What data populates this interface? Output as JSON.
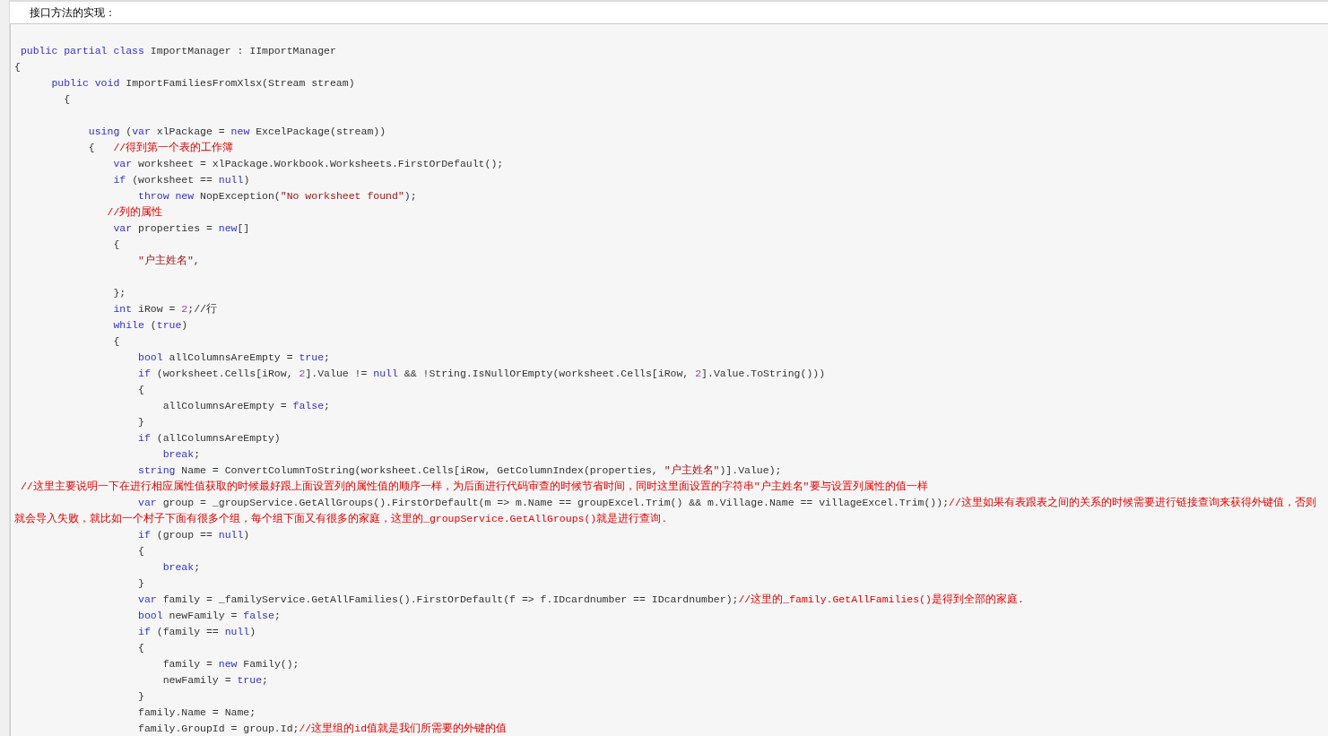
{
  "heading": "接口方法的实现：",
  "code_lines": [
    [
      {
        "kind": "keyword",
        "text": " public partial class"
      },
      {
        "kind": "plain",
        "text": " ImportManager : IImportManager"
      }
    ],
    [
      {
        "kind": "plain",
        "text": "{"
      }
    ],
    [
      {
        "kind": "keyword",
        "text": "      public void"
      },
      {
        "kind": "plain",
        "text": " ImportFamiliesFromXlsx(Stream stream)"
      }
    ],
    [
      {
        "kind": "plain",
        "text": "        {"
      }
    ],
    [
      {
        "kind": "blank"
      }
    ],
    [
      {
        "kind": "keyword",
        "text": "            using"
      },
      {
        "kind": "plain",
        "text": " ("
      },
      {
        "kind": "keyword",
        "text": "var"
      },
      {
        "kind": "plain",
        "text": " xlPackage = "
      },
      {
        "kind": "keyword",
        "text": "new"
      },
      {
        "kind": "plain",
        "text": " ExcelPackage(stream))"
      }
    ],
    [
      {
        "kind": "plain",
        "text": "            {   "
      },
      {
        "kind": "comment",
        "text": "//得到第一个表的工作簿"
      }
    ],
    [
      {
        "kind": "keyword",
        "text": "                var"
      },
      {
        "kind": "plain",
        "text": " worksheet = xlPackage.Workbook.Worksheets.FirstOrDefault();"
      }
    ],
    [
      {
        "kind": "keyword",
        "text": "                if"
      },
      {
        "kind": "plain",
        "text": " (worksheet == "
      },
      {
        "kind": "keyword",
        "text": "null"
      },
      {
        "kind": "plain",
        "text": ")"
      }
    ],
    [
      {
        "kind": "keyword",
        "text": "                    throw new"
      },
      {
        "kind": "plain",
        "text": " NopException("
      },
      {
        "kind": "string",
        "text": "\"No worksheet found\""
      },
      {
        "kind": "plain",
        "text": ");"
      }
    ],
    [
      {
        "kind": "comment",
        "text": "               //列的属性"
      }
    ],
    [
      {
        "kind": "keyword",
        "text": "                var"
      },
      {
        "kind": "plain",
        "text": " properties = "
      },
      {
        "kind": "keyword",
        "text": "new"
      },
      {
        "kind": "plain",
        "text": "[]"
      }
    ],
    [
      {
        "kind": "plain",
        "text": "                {"
      }
    ],
    [
      {
        "kind": "string",
        "text": "                    \"户主姓名\""
      },
      {
        "kind": "plain",
        "text": ","
      }
    ],
    [
      {
        "kind": "blank"
      }
    ],
    [
      {
        "kind": "plain",
        "text": "                };"
      }
    ],
    [
      {
        "kind": "keyword",
        "text": "                int"
      },
      {
        "kind": "plain",
        "text": " iRow = "
      },
      {
        "kind": "number",
        "text": "2"
      },
      {
        "kind": "plain",
        "text": ";//行"
      }
    ],
    [
      {
        "kind": "keyword",
        "text": "                while"
      },
      {
        "kind": "plain",
        "text": " ("
      },
      {
        "kind": "keyword",
        "text": "true"
      },
      {
        "kind": "plain",
        "text": ")"
      }
    ],
    [
      {
        "kind": "plain",
        "text": "                {"
      }
    ],
    [
      {
        "kind": "keyword",
        "text": "                    bool"
      },
      {
        "kind": "plain",
        "text": " allColumnsAreEmpty = "
      },
      {
        "kind": "keyword",
        "text": "true"
      },
      {
        "kind": "plain",
        "text": ";"
      }
    ],
    [
      {
        "kind": "keyword",
        "text": "                    if"
      },
      {
        "kind": "plain",
        "text": " (worksheet.Cells[iRow, "
      },
      {
        "kind": "number",
        "text": "2"
      },
      {
        "kind": "plain",
        "text": "].Value != "
      },
      {
        "kind": "keyword",
        "text": "null"
      },
      {
        "kind": "plain",
        "text": " && !String.IsNullOrEmpty(worksheet.Cells[iRow, "
      },
      {
        "kind": "number",
        "text": "2"
      },
      {
        "kind": "plain",
        "text": "].Value.ToString()))"
      }
    ],
    [
      {
        "kind": "plain",
        "text": "                    {"
      }
    ],
    [
      {
        "kind": "plain",
        "text": "                        allColumnsAreEmpty = "
      },
      {
        "kind": "keyword",
        "text": "false"
      },
      {
        "kind": "plain",
        "text": ";"
      }
    ],
    [
      {
        "kind": "plain",
        "text": "                    }"
      }
    ],
    [
      {
        "kind": "keyword",
        "text": "                    if"
      },
      {
        "kind": "plain",
        "text": " (allColumnsAreEmpty)"
      }
    ],
    [
      {
        "kind": "keyword",
        "text": "                        break"
      },
      {
        "kind": "plain",
        "text": ";"
      }
    ],
    [
      {
        "kind": "keyword",
        "text": "                    string"
      },
      {
        "kind": "plain",
        "text": " Name = ConvertColumnToString(worksheet.Cells[iRow, GetColumnIndex(properties, "
      },
      {
        "kind": "string",
        "text": "\"户主姓名\""
      },
      {
        "kind": "plain",
        "text": ")].Value);"
      }
    ],
    [
      {
        "kind": "comment",
        "text": " //这里主要说明一下在进行相应属性值获取的时候最好跟上面设置列的属性值的顺序一样，为后面进行代码审查的时候节省时间，同时这里面设置的字符串\"户主姓名\"要与设置列属性的值一样"
      }
    ],
    [
      {
        "kind": "keyword",
        "text": "                    var"
      },
      {
        "kind": "plain",
        "text": " group = _groupService.GetAllGroups().FirstOrDefault(m => m.Name == groupExcel.Trim() && m.Village.Name == villageExcel.Trim());"
      },
      {
        "kind": "comment",
        "text": "//这里如果有表跟表之间的关系的时候需要进行链接查询来获得外键值，否则"
      }
    ],
    [
      {
        "kind": "comment",
        "text": "就会导入失败，就比如一个村子下面有很多个组，每个组下面又有很多的家庭，这里的_groupService.GetAllGroups()就是进行查询."
      }
    ],
    [
      {
        "kind": "keyword",
        "text": "                    if"
      },
      {
        "kind": "plain",
        "text": " (group == "
      },
      {
        "kind": "keyword",
        "text": "null"
      },
      {
        "kind": "plain",
        "text": ")"
      }
    ],
    [
      {
        "kind": "plain",
        "text": "                    {"
      }
    ],
    [
      {
        "kind": "keyword",
        "text": "                        break"
      },
      {
        "kind": "plain",
        "text": ";"
      }
    ],
    [
      {
        "kind": "plain",
        "text": "                    }"
      }
    ],
    [
      {
        "kind": "keyword",
        "text": "                    var"
      },
      {
        "kind": "plain",
        "text": " family = _familyService.GetAllFamilies().FirstOrDefault(f => f.IDcardnumber == IDcardnumber);"
      },
      {
        "kind": "comment",
        "text": "//这里的_family.GetAllFamilies()是得到全部的家庭."
      }
    ],
    [
      {
        "kind": "keyword",
        "text": "                    bool"
      },
      {
        "kind": "plain",
        "text": " newFamily = "
      },
      {
        "kind": "keyword",
        "text": "false"
      },
      {
        "kind": "plain",
        "text": ";"
      }
    ],
    [
      {
        "kind": "keyword",
        "text": "                    if"
      },
      {
        "kind": "plain",
        "text": " (family == "
      },
      {
        "kind": "keyword",
        "text": "null"
      },
      {
        "kind": "plain",
        "text": ")"
      }
    ],
    [
      {
        "kind": "plain",
        "text": "                    {"
      }
    ],
    [
      {
        "kind": "plain",
        "text": "                        family = "
      },
      {
        "kind": "keyword",
        "text": "new"
      },
      {
        "kind": "plain",
        "text": " Family();"
      }
    ],
    [
      {
        "kind": "plain",
        "text": "                        newFamily = "
      },
      {
        "kind": "keyword",
        "text": "true"
      },
      {
        "kind": "plain",
        "text": ";"
      }
    ],
    [
      {
        "kind": "plain",
        "text": "                    }"
      }
    ],
    [
      {
        "kind": "plain",
        "text": "                    family.Name = Name;"
      }
    ],
    [
      {
        "kind": "plain",
        "text": "                    family.GroupId = group.Id;"
      },
      {
        "kind": "comment",
        "text": "//这里组的id值就是我们所需要的外键的值"
      }
    ]
  ]
}
